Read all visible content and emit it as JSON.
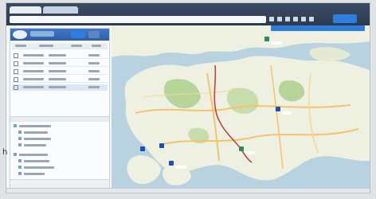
{
  "caption": {
    "text": "h"
  },
  "colors": {
    "browser_bar": "#2b3a4f",
    "app_header": "#2d5fa7",
    "accent_blue": "#2f7ddc",
    "water": "#b8d2df",
    "land": "#eef0e2",
    "park": "#b7d49a",
    "road": "#f4c36b",
    "route": "#c1443c"
  },
  "markers": [
    {
      "name": "green",
      "color": "#2e8b57"
    },
    {
      "name": "blue",
      "color": "#1d4fb0"
    },
    {
      "name": "blue",
      "color": "#1d4fb0"
    },
    {
      "name": "blue",
      "color": "#1d4fb0"
    },
    {
      "name": "green",
      "color": "#2e8b57"
    }
  ],
  "icons": [
    "logo-icon",
    "checkbox-icon",
    "tree-folder-icon",
    "map-marker-icon"
  ]
}
